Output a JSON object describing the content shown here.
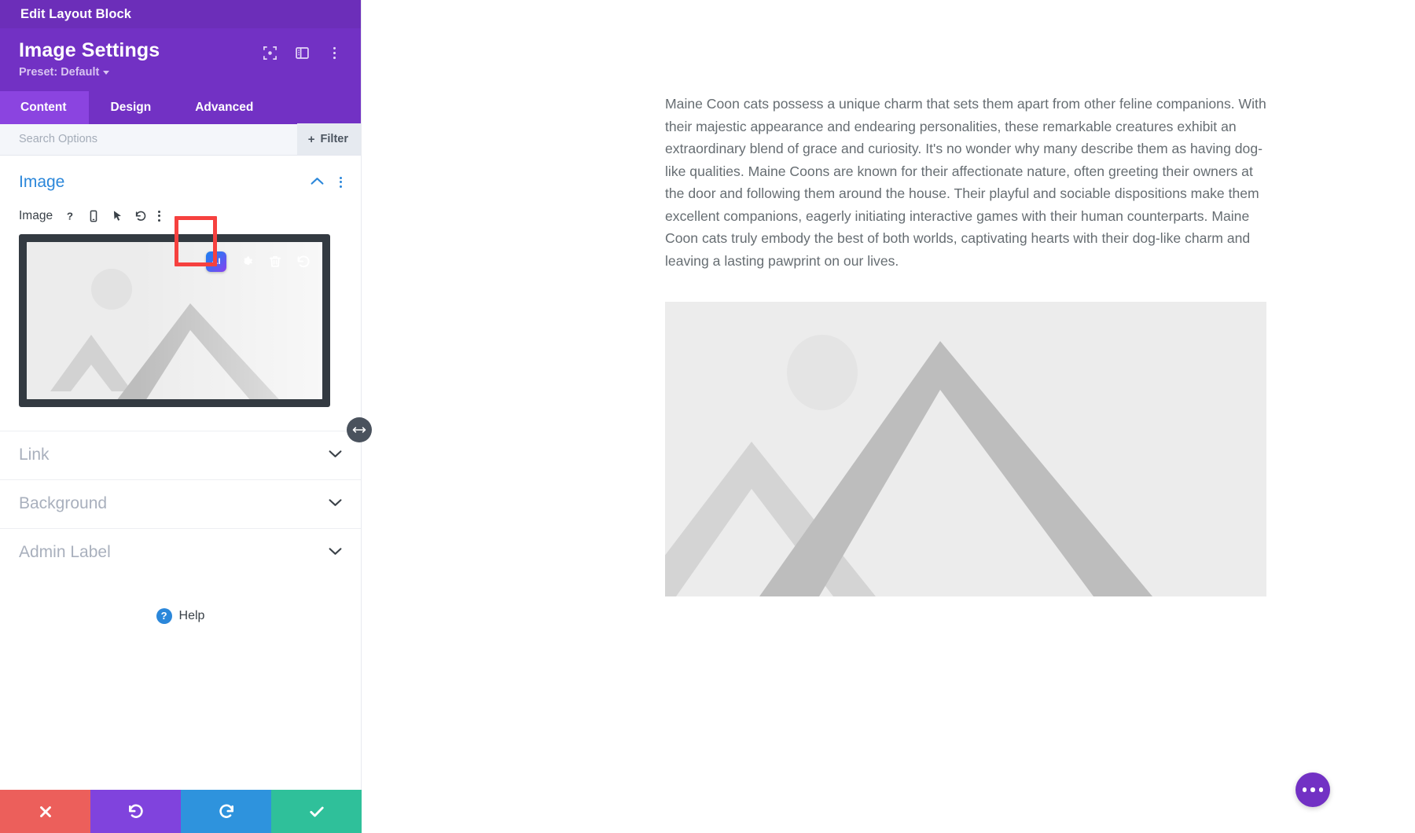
{
  "window": {
    "title": "Edit Layout Block"
  },
  "panel": {
    "module_title": "Image Settings",
    "preset_label": "Preset: Default",
    "header_icons": [
      {
        "name": "expand-icon"
      },
      {
        "name": "layout-columns-icon"
      },
      {
        "name": "more-vertical-icon"
      }
    ],
    "tabs": [
      {
        "label": "Content",
        "active": true
      },
      {
        "label": "Design",
        "active": false
      },
      {
        "label": "Advanced",
        "active": false
      }
    ],
    "search": {
      "value": "",
      "placeholder": "Search Options"
    },
    "filter_button": {
      "label": "Filter",
      "plus": "+"
    },
    "sections": [
      {
        "title": "Image",
        "state": "open"
      },
      {
        "title": "Link",
        "state": "closed"
      },
      {
        "title": "Background",
        "state": "closed"
      },
      {
        "title": "Admin Label",
        "state": "closed"
      }
    ],
    "image_field": {
      "label": "Image",
      "icons": [
        {
          "name": "help-question-icon",
          "glyph": "?"
        },
        {
          "name": "mobile-device-icon"
        },
        {
          "name": "cursor-pointer-icon"
        },
        {
          "name": "reset-undo-icon"
        },
        {
          "name": "more-vertical-icon"
        }
      ],
      "preview_toolbar": [
        {
          "name": "ai-generate-button",
          "label": "AI",
          "highlighted": true
        },
        {
          "name": "settings-gear-icon"
        },
        {
          "name": "delete-trash-icon"
        },
        {
          "name": "reset-undo-icon"
        }
      ]
    },
    "help": {
      "label": "Help",
      "badge": "?"
    },
    "actions": [
      {
        "name": "cancel-button",
        "icon": "close-x-icon",
        "color": "#ec5f5b"
      },
      {
        "name": "undo-button",
        "icon": "undo-arrow-icon",
        "color": "#8043dd"
      },
      {
        "name": "redo-button",
        "icon": "redo-arrow-icon",
        "color": "#2e93dd"
      },
      {
        "name": "save-button",
        "icon": "checkmark-icon",
        "color": "#2fc09a"
      }
    ],
    "resize_handle": {
      "name": "panel-resize-handle",
      "icon": "left-right-arrow-icon"
    }
  },
  "content": {
    "paragraph": "Maine Coon cats possess a unique charm that sets them apart from other feline companions. With their majestic appearance and endearing personalities, these remarkable creatures exhibit an extraordinary blend of grace and curiosity. It's no wonder why many describe them as having dog-like qualities. Maine Coons are known for their affectionate nature, often greeting their owners at the door and following them around the house. Their playful and sociable dispositions make them excellent companions, eagerly initiating interactive games with their human counterparts. Maine Coon cats truly embody the best of both worlds, captivating hearts with their dog-like charm and leaving a lasting pawprint on our lives.",
    "placeholder_image": {
      "name": "image-placeholder-mountains"
    },
    "fab": {
      "name": "page-settings-fab",
      "icon": "more-horizontal-icon"
    }
  },
  "colors": {
    "brand_purple": "#7231c4",
    "topbar_purple": "#6c2eb9",
    "active_tab_purple": "#8b44e0",
    "link_blue": "#2b87da",
    "highlight_red": "#f6413f",
    "cancel_red": "#ec5f5b",
    "undo_purple": "#8043dd",
    "redo_blue": "#2e93dd",
    "save_green": "#2fc09a"
  }
}
